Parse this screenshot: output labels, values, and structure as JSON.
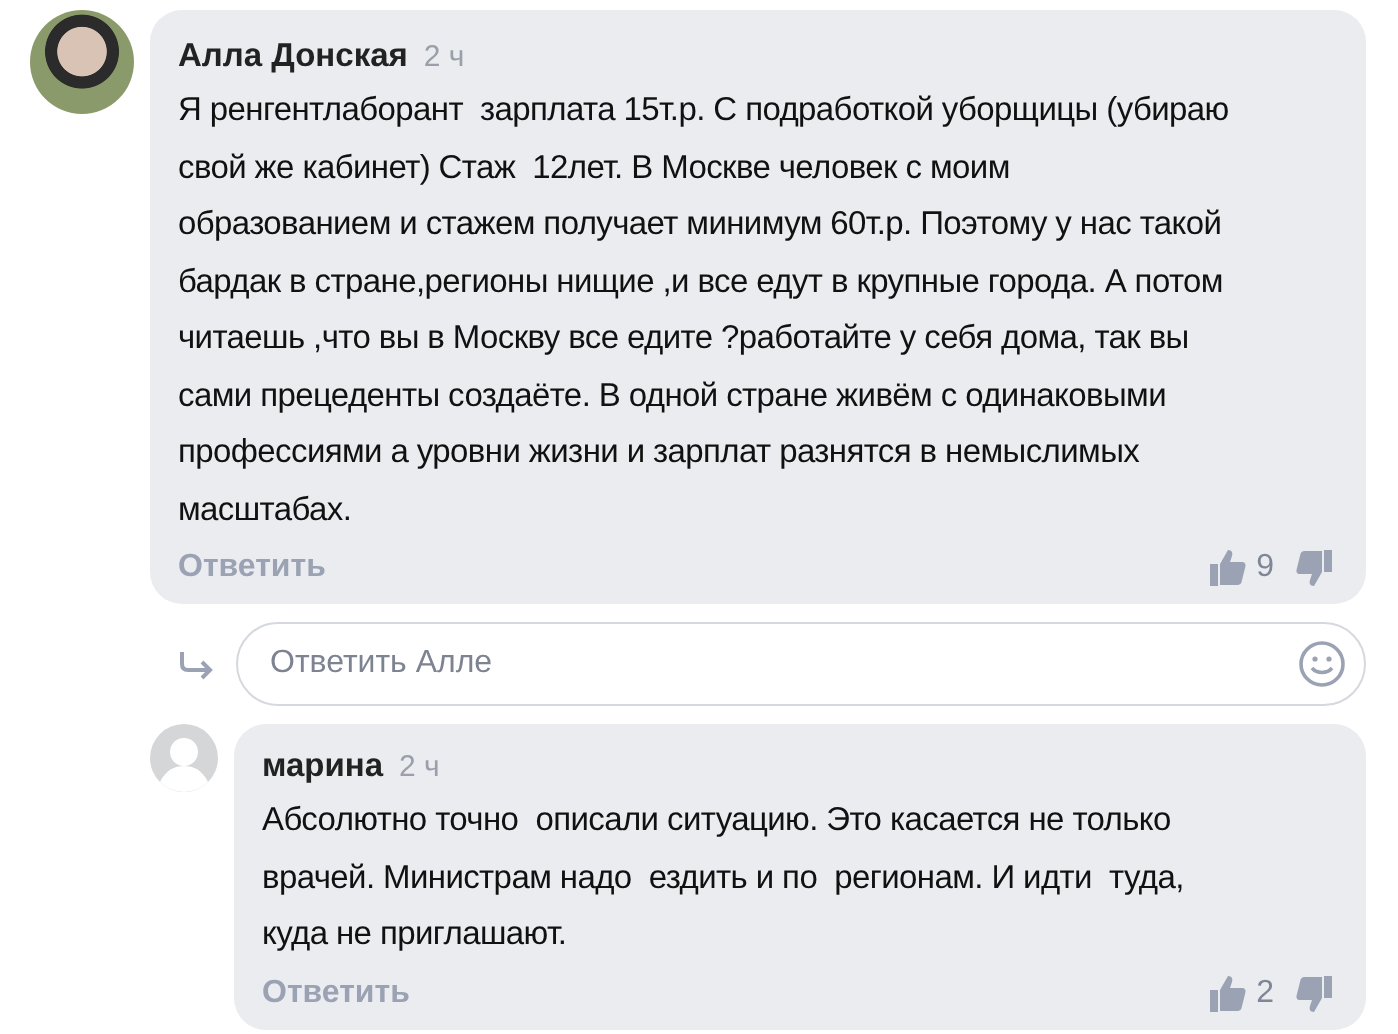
{
  "comments": [
    {
      "author": "Алла Донская",
      "time": "2 ч",
      "kind": "photo",
      "text": "Я ренгентлаборант  зарплата 15т.р. С подработкой уборщицы (убираю\nсвой же кабинет) Стаж  12лет. В Москве человек с моим\nобразованием и стажем получает минимум 60т.р. Поэтому у нас такой\nбардак в стране,регионы нищие ,и все едут в крупные города. А потом\nчитаешь ,что вы в Москву все едите ?работайте у себя дома, так вы\nсами прецеденты создаёте. В одной стране живём с одинаковыми\nпрофессиями а уровни жизни и зарплат разнятся в немыслимых\nмасштабах.",
      "reply_label": "Ответить",
      "likes": "9",
      "reply_field": {
        "placeholder": "Ответить Алле"
      },
      "replies": [
        {
          "author": "марина",
          "time": "2 ч",
          "kind": "silhouette",
          "text": "Абсолютно точно  описали ситуацию. Это касается не только\nврачей. Министрам надо  ездить и по  регионам. И идти  туда,\nкуда не приглашают.",
          "reply_label": "Ответить",
          "likes": "2"
        }
      ]
    }
  ]
}
